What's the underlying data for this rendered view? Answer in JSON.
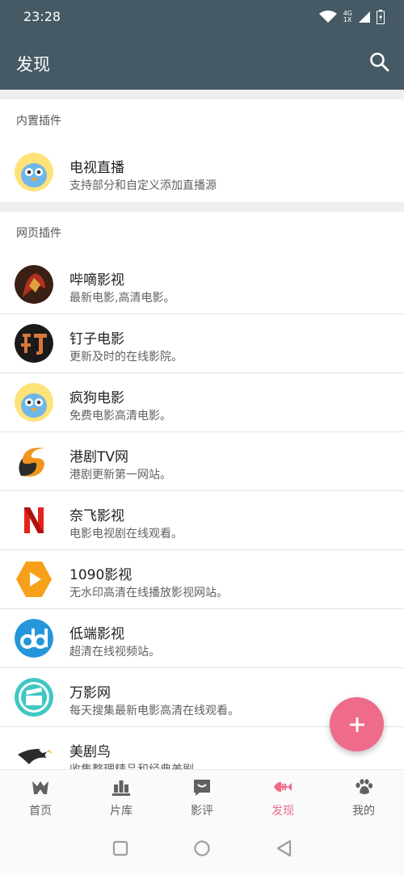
{
  "status": {
    "time": "23:28",
    "network": "4G",
    "sim": "1X"
  },
  "appbar": {
    "title": "发现"
  },
  "sections": [
    {
      "header": "内置插件",
      "items": [
        {
          "title": "电视直播",
          "subtitle": "支持部分和自定义添加直播源",
          "icon": "bird-icon"
        }
      ]
    },
    {
      "header": "网页插件",
      "items": [
        {
          "title": "哔嘀影视",
          "subtitle": "最新电影,高清电影。",
          "icon": "hero-avatar-icon"
        },
        {
          "title": "钉子电影",
          "subtitle": "更新及时的在线影院。",
          "icon": "ding-logo-icon"
        },
        {
          "title": "疯狗电影",
          "subtitle": "免费电影高清电影。",
          "icon": "bird-icon"
        },
        {
          "title": "港剧TV网",
          "subtitle": "港剧更新第一网站。",
          "icon": "s-logo-icon"
        },
        {
          "title": "奈飞影视",
          "subtitle": "电影电视剧在线观看。",
          "icon": "netflix-logo-icon"
        },
        {
          "title": "1090影视",
          "subtitle": "无水印高清在线播放影视网站。",
          "icon": "play-logo-icon"
        },
        {
          "title": "低端影视",
          "subtitle": "超清在线视频站。",
          "icon": "dd-logo-icon"
        },
        {
          "title": "万影网",
          "subtitle": "每天搜集最新电影高清在线观看。",
          "icon": "clapper-logo-icon"
        },
        {
          "title": "美剧鸟",
          "subtitle": "收集整理精品和经典美剧。",
          "icon": "eagle-logo-icon"
        }
      ]
    }
  ],
  "bottom_nav": [
    {
      "label": "首页",
      "icon": "home-icon"
    },
    {
      "label": "片库",
      "icon": "library-icon"
    },
    {
      "label": "影评",
      "icon": "review-icon"
    },
    {
      "label": "发现",
      "icon": "fish-icon",
      "active": true
    },
    {
      "label": "我的",
      "icon": "paw-icon"
    }
  ],
  "colors": {
    "appbar": "#455a64",
    "accent": "#ef6b8a",
    "divider": "#e3e3e3"
  }
}
